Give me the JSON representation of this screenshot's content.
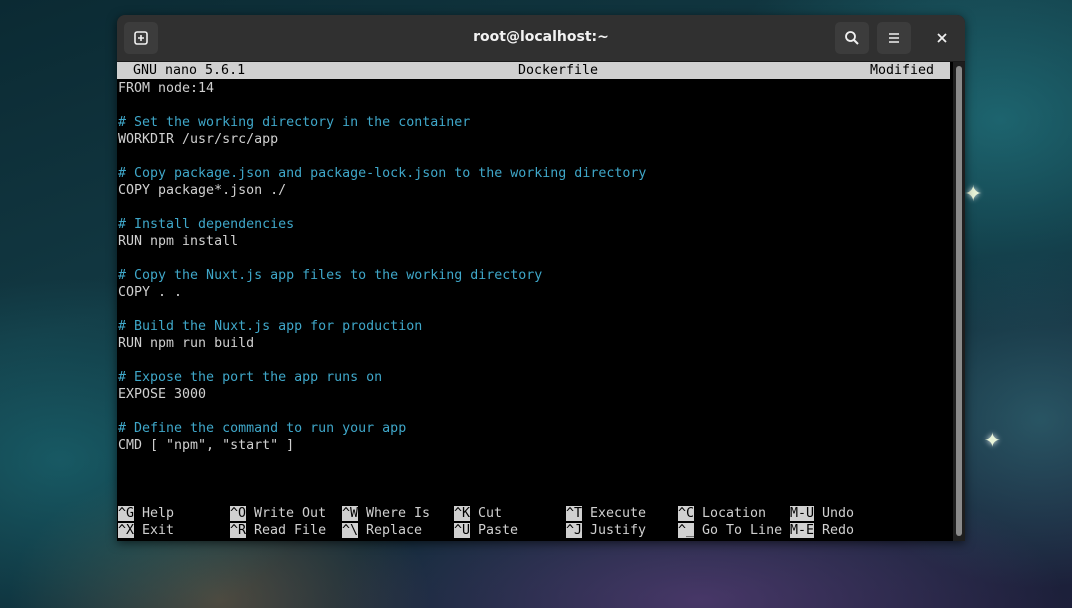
{
  "window": {
    "title": "root@localhost:~"
  },
  "nano": {
    "version": "GNU nano 5.6.1",
    "filename": "Dockerfile",
    "status": "Modified"
  },
  "file_lines": [
    "FROM node:14",
    "",
    "# Set the working directory in the container",
    "WORKDIR /usr/src/app",
    "",
    "# Copy package.json and package-lock.json to the working directory",
    "COPY package*.json ./",
    "",
    "# Install dependencies",
    "RUN npm install",
    "",
    "# Copy the Nuxt.js app files to the working directory",
    "COPY . .",
    "",
    "# Build the Nuxt.js app for production",
    "RUN npm run build",
    "",
    "# Expose the port the app runs on",
    "EXPOSE 3000",
    "",
    "# Define the command to run your app",
    "CMD [ \"npm\", \"start\" ]"
  ],
  "shortcuts": [
    {
      "key": "^G",
      "label": "Help"
    },
    {
      "key": "^O",
      "label": "Write Out"
    },
    {
      "key": "^W",
      "label": "Where Is"
    },
    {
      "key": "^K",
      "label": "Cut"
    },
    {
      "key": "^T",
      "label": "Execute"
    },
    {
      "key": "^C",
      "label": "Location"
    },
    {
      "key": "M-U",
      "label": "Undo"
    },
    {
      "key": "^X",
      "label": "Exit"
    },
    {
      "key": "^R",
      "label": "Read File"
    },
    {
      "key": "^\\",
      "label": "Replace"
    },
    {
      "key": "^U",
      "label": "Paste"
    },
    {
      "key": "^J",
      "label": "Justify"
    },
    {
      "key": "^_",
      "label": "Go To Line"
    },
    {
      "key": "M-E",
      "label": "Redo"
    }
  ],
  "icons": {
    "new_tab": "new-tab-icon",
    "search": "search-icon",
    "menu": "hamburger-menu-icon",
    "close": "close-icon"
  },
  "colors": {
    "comment": "#3fa7c9",
    "text": "#d0d0d0",
    "header_bg": "#d0d0d0"
  }
}
